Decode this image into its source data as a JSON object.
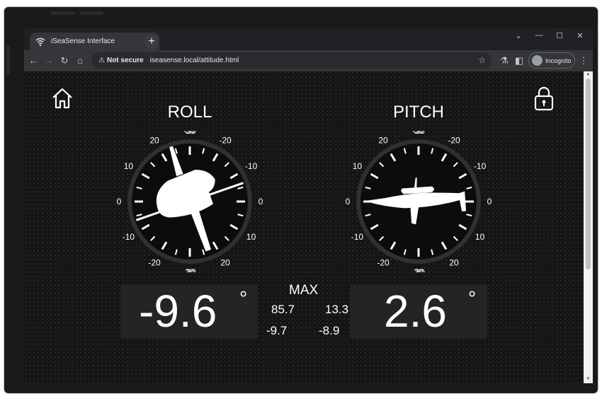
{
  "browser": {
    "tab_title": "iSeaSense Interface",
    "security_label": "Not secure",
    "url": "iseasense.local/attitude.html",
    "profile_label": "Incognito"
  },
  "page": {
    "roll": {
      "title": "ROLL",
      "value": "-9.6",
      "degree_symbol": "°",
      "angle": -9.6,
      "tick_labels": {
        "right": [
          "-30",
          "-20",
          "-10",
          "0",
          "10",
          "20",
          "30"
        ],
        "left": [
          "30",
          "20",
          "10",
          "0",
          "-10",
          "-20",
          "-30"
        ]
      }
    },
    "pitch": {
      "title": "PITCH",
      "value": "2.6",
      "degree_symbol": "°",
      "angle": 2.6,
      "tick_labels": {
        "right": [
          "-30",
          "-20",
          "-10",
          "0",
          "10",
          "20",
          "30"
        ],
        "left": [
          "30",
          "20",
          "10",
          "0",
          "-10",
          "-20",
          "-30"
        ]
      }
    },
    "max": {
      "label": "MAX",
      "roll_pos": "85.7",
      "pitch_pos": "13.3",
      "roll_neg": "-9.7",
      "pitch_neg": "-8.9"
    },
    "icons": {
      "home": "home-icon",
      "lock": "lock-icon"
    }
  }
}
